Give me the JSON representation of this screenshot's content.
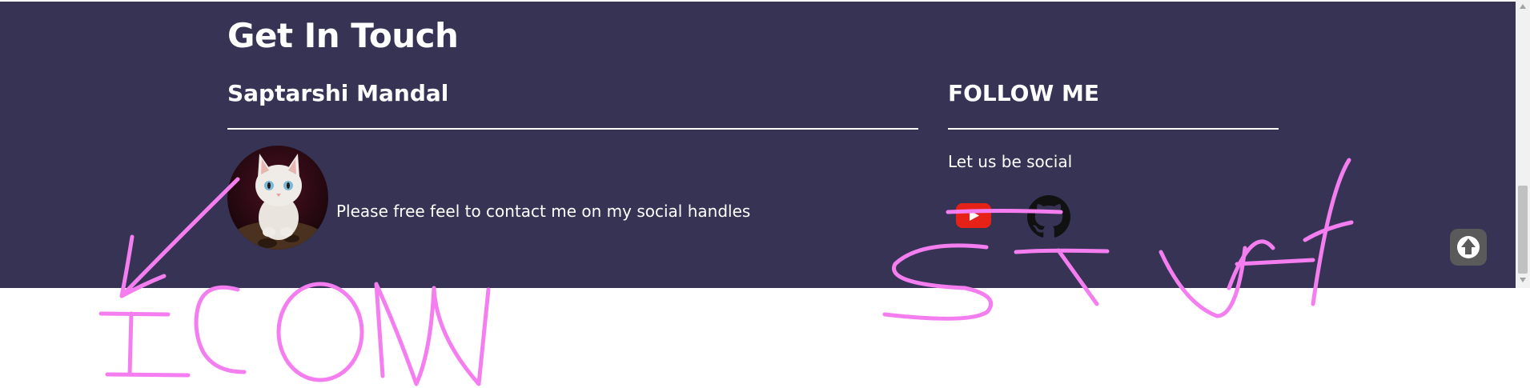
{
  "footer": {
    "title": "Get In Touch",
    "name": "Saptarshi Mandal",
    "contact_message": "Please free feel to contact me on my social handles",
    "follow_heading": "FOLLOW ME",
    "social_tagline": "Let us be social",
    "background_color": "#363355",
    "text_color": "#ffffff"
  },
  "social_icons": [
    "youtube-icon",
    "github-icon"
  ],
  "scroll_to_top_icon": "arrow-up-icon",
  "annotations": {
    "color": "#f47ef0",
    "left_label": "ICON",
    "right_label": "STUFF"
  }
}
